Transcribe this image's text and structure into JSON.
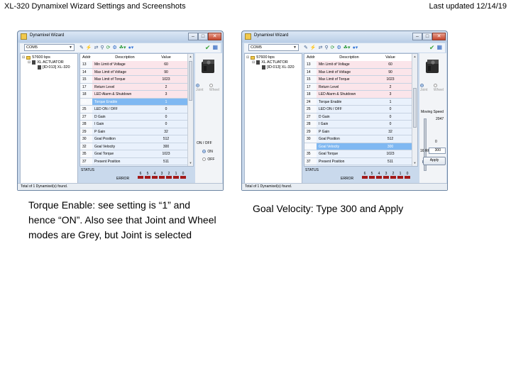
{
  "header": {
    "title": "XL-320 Dynamixel Wizard Settings and Screenshots",
    "updated": "Last updated 12/14/19"
  },
  "windows": [
    {
      "title": "Dynamixel Wizard",
      "port": "COM5",
      "tree": {
        "baud": "57600 bps",
        "group": "XL ACTUATOR",
        "device": "[ID:013] XL-320"
      },
      "columns": {
        "addr": "Addr",
        "desc": "Description",
        "value": "Value"
      },
      "rows": [
        {
          "addr": "13",
          "desc": "Min Limit of Voltage",
          "value": "60",
          "style": "pink"
        },
        {
          "addr": "14",
          "desc": "Max Limit of Voltage",
          "value": "90",
          "style": "pink"
        },
        {
          "addr": "15",
          "desc": "Max Limit of Torque",
          "value": "1023",
          "style": "pink"
        },
        {
          "addr": "17",
          "desc": "Return Level",
          "value": "2",
          "style": "pink"
        },
        {
          "addr": "18",
          "desc": "LED Alarm & Shutdown",
          "value": "3",
          "style": "pink"
        },
        {
          "addr": "24",
          "desc": "Torque Enable",
          "value": "1",
          "style": "sel"
        },
        {
          "addr": "25",
          "desc": "LED ON / OFF",
          "value": "0",
          "style": "blue"
        },
        {
          "addr": "27",
          "desc": "D Gain",
          "value": "0",
          "style": "blue"
        },
        {
          "addr": "28",
          "desc": "I Gain",
          "value": "0",
          "style": "blue"
        },
        {
          "addr": "29",
          "desc": "P Gain",
          "value": "32",
          "style": "blue"
        },
        {
          "addr": "30",
          "desc": "Goal Position",
          "value": "512",
          "style": "blue"
        },
        {
          "addr": "32",
          "desc": "Goal Velocity",
          "value": "300",
          "style": "blue"
        },
        {
          "addr": "35",
          "desc": "Goal Torque",
          "value": "1023",
          "style": "blue"
        },
        {
          "addr": "37",
          "desc": "Present Position",
          "value": "511",
          "style": "blue"
        },
        {
          "addr": "39",
          "desc": "Present Velocity",
          "value": "0",
          "style": "blue"
        }
      ],
      "status_label": "STATUS",
      "error_label": "ERROR",
      "error_bits": [
        "6",
        "5",
        "4",
        "3",
        "2",
        "1",
        "0"
      ],
      "mode": {
        "joint": "Joint",
        "wheel": "Wheel"
      },
      "on_off_group": "ON / OFF",
      "on_label": "ON",
      "off_label": "OFF",
      "statusbar": "Total of 1 Dynamixel(s) found."
    },
    {
      "title": "Dynamixel Wizard",
      "port": "COM5",
      "tree": {
        "baud": "57600 bps",
        "group": "XL ACTUATOR",
        "device": "[ID:013] XL-320"
      },
      "columns": {
        "addr": "Addr",
        "desc": "Description",
        "value": "Value"
      },
      "rows": [
        {
          "addr": "13",
          "desc": "Min Limit of Voltage",
          "value": "60",
          "style": "pink"
        },
        {
          "addr": "14",
          "desc": "Max Limit of Voltage",
          "value": "90",
          "style": "pink"
        },
        {
          "addr": "15",
          "desc": "Max Limit of Torque",
          "value": "1023",
          "style": "pink"
        },
        {
          "addr": "17",
          "desc": "Return Level",
          "value": "2",
          "style": "pink"
        },
        {
          "addr": "18",
          "desc": "LED Alarm & Shutdown",
          "value": "3",
          "style": "pink"
        },
        {
          "addr": "24",
          "desc": "Torque Enable",
          "value": "1",
          "style": "blue"
        },
        {
          "addr": "25",
          "desc": "LED ON / OFF",
          "value": "0",
          "style": "blue"
        },
        {
          "addr": "27",
          "desc": "D Gain",
          "value": "0",
          "style": "blue"
        },
        {
          "addr": "28",
          "desc": "I Gain",
          "value": "0",
          "style": "blue"
        },
        {
          "addr": "29",
          "desc": "P Gain",
          "value": "32",
          "style": "blue"
        },
        {
          "addr": "30",
          "desc": "Goal Position",
          "value": "512",
          "style": "blue"
        },
        {
          "addr": "32",
          "desc": "Goal Velocity",
          "value": "300",
          "style": "sel"
        },
        {
          "addr": "35",
          "desc": "Goal Torque",
          "value": "1023",
          "style": "blue"
        },
        {
          "addr": "37",
          "desc": "Present Position",
          "value": "511",
          "style": "blue"
        },
        {
          "addr": "39",
          "desc": "Present Velocity",
          "value": "0",
          "style": "blue"
        }
      ],
      "status_label": "STATUS",
      "error_label": "ERROR",
      "error_bits": [
        "6",
        "5",
        "4",
        "3",
        "2",
        "1",
        "0"
      ],
      "mode": {
        "joint": "Joint",
        "wheel": "Wheel"
      },
      "speed_group": "Moving Speed",
      "speed_max": "2047",
      "speed_min": "0",
      "speed_level": 0.15,
      "rpm_label": "16 RPM",
      "speed_value": "300",
      "apply_label": "Apply",
      "statusbar": "Total of 1 Dynamixel(s) found."
    }
  ],
  "captions": {
    "left": "Torque Enable: see setting is “1” and hence “ON”. Also see that Joint and Wheel modes are Grey, but Joint is selected",
    "right": "Goal Velocity: Type 300 and Apply"
  }
}
